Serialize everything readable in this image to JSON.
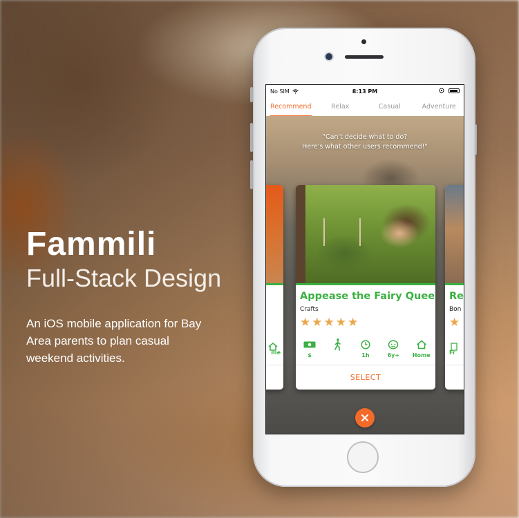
{
  "headline": {
    "brand": "Fammili",
    "subtitle": "Full-Stack Design",
    "description": "An iOS mobile application for Bay Area parents to plan casual weekend activities."
  },
  "status_bar": {
    "carrier": "No SIM",
    "time": "8:13 PM"
  },
  "tabs": [
    {
      "label": "Recommend",
      "active": true
    },
    {
      "label": "Relax",
      "active": false
    },
    {
      "label": "Casual",
      "active": false
    },
    {
      "label": "Adventure",
      "active": false
    }
  ],
  "tagline": {
    "line1": "\"Can't decide what to do?",
    "line2": "Here's what other users recommend!\""
  },
  "card": {
    "title": "Appease the Fairy Queen",
    "category": "Crafts",
    "rating": 5,
    "stars": "★★★★★",
    "attributes": [
      {
        "icon": "money-icon",
        "label": "$"
      },
      {
        "icon": "walking-icon",
        "label": ""
      },
      {
        "icon": "clock-icon",
        "label": "1h"
      },
      {
        "icon": "child-face-icon",
        "label": "6y+"
      },
      {
        "icon": "home-icon",
        "label": "Home"
      }
    ],
    "select_label": "SELECT"
  },
  "left_card": {
    "label": "me"
  },
  "right_card": {
    "title": "Re",
    "category": "Bon",
    "star": "★",
    "label": "Fr"
  },
  "colors": {
    "accent_orange": "#f26b2a",
    "accent_green": "#3cb043",
    "star": "#e9a84a"
  }
}
